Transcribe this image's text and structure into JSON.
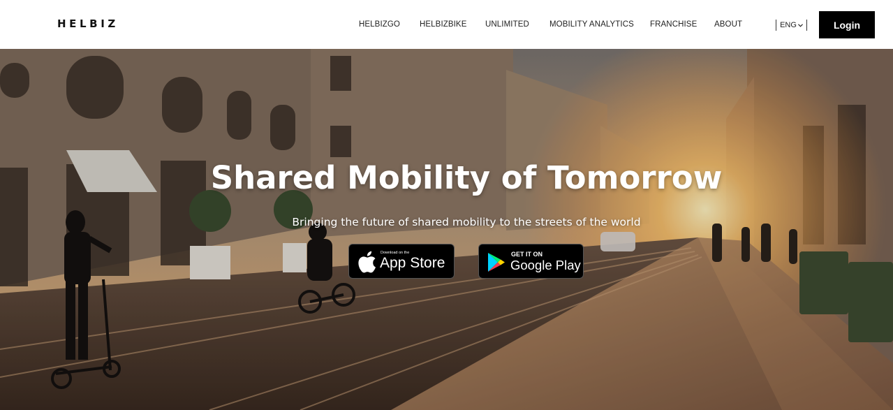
{
  "header": {
    "logo": "HELBIZ",
    "nav": [
      {
        "label": "HELBIZGO"
      },
      {
        "label": "HELBIZBIKE"
      },
      {
        "label": "UNLIMITED"
      },
      {
        "label": "MOBILITY ANALYTICS"
      },
      {
        "label": "FRANCHISE"
      },
      {
        "label": "ABOUT"
      }
    ],
    "language": "ENG",
    "login_label": "Login"
  },
  "hero": {
    "title": "Shared Mobility of Tomorrow",
    "subtitle": "Bringing the future of shared mobility to the streets of the world",
    "app_store": {
      "small": "Download on the",
      "big": "App Store"
    },
    "google_play": {
      "small": "GET IT ON",
      "big": "Google Play"
    }
  },
  "icons": [
    "apple-icon",
    "google-play-icon",
    "chevron-down-icon"
  ],
  "colors": {
    "login_bg": "#000000",
    "header_bg": "#ffffff",
    "hero_text": "#ffffff"
  }
}
